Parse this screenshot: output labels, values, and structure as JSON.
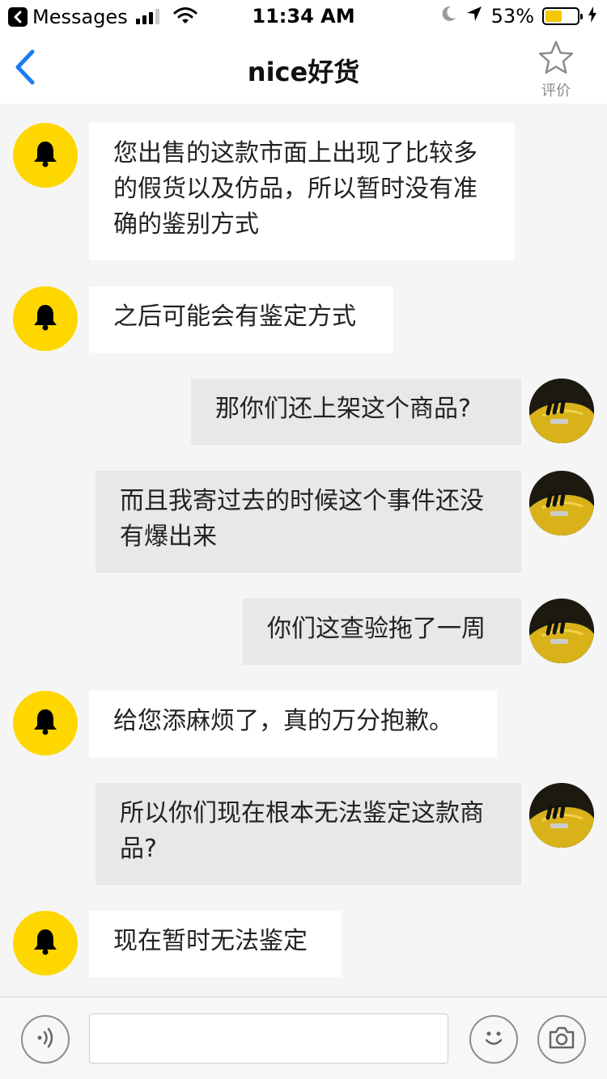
{
  "status_bar": {
    "back_app_label": "Messages",
    "time": "11:34 AM",
    "battery_percent": "53%",
    "battery_level": 0.53,
    "signal_bars": 3,
    "icons": [
      "back-chevron-icon",
      "signal-icon",
      "wifi-icon",
      "moon-icon",
      "location-arrow-icon",
      "battery-icon",
      "charging-bolt-icon"
    ]
  },
  "nav": {
    "title": "nice好货",
    "rate_label": "评价",
    "icons": [
      "back-icon",
      "star-icon"
    ]
  },
  "messages": [
    {
      "side": "left",
      "text": "您出售的这款市面上出现了比较多的假货以及仿品，所以暂时没有准确的鉴别方式"
    },
    {
      "side": "left",
      "text": "之后可能会有鉴定方式"
    },
    {
      "side": "right",
      "text": "那你们还上架这个商品?"
    },
    {
      "side": "right",
      "text": "而且我寄过去的时候这个事件还没有爆出来"
    },
    {
      "side": "right",
      "text": "你们这查验拖了一周"
    },
    {
      "side": "left",
      "text": "给您添麻烦了，真的万分抱歉。"
    },
    {
      "side": "right",
      "text": "所以你们现在根本无法鉴定这款商品?"
    },
    {
      "side": "left",
      "text": "现在暂时无法鉴定"
    }
  ],
  "input_bar": {
    "text_value": "",
    "icons": [
      "voice-icon",
      "emoji-icon",
      "camera-icon"
    ]
  },
  "colors": {
    "accent_blue": "#1a7cf0",
    "bell_yellow": "#ffd700",
    "battery_yellow": "#f5c800",
    "left_bubble": "#ffffff",
    "right_bubble": "#e8e8e8",
    "background": "#f5f5f5"
  }
}
